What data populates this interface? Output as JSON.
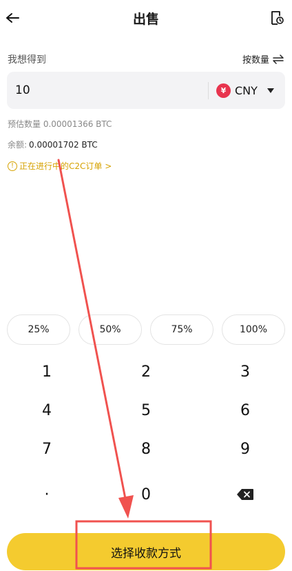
{
  "header": {
    "title": "出售"
  },
  "form": {
    "want_label": "我想得到",
    "by_quantity_label": "按数量",
    "amount_value": "10",
    "currency_symbol": "¥",
    "currency_code": "CNY",
    "estimate_text": "预估数量 0.00001366 BTC",
    "balance_label": "余额:",
    "balance_value": "0.00001702 BTC",
    "c2c_link_text": "正在进行中的C2C订单 >"
  },
  "percent_buttons": [
    "25%",
    "50%",
    "75%",
    "100%"
  ],
  "keypad": {
    "keys": [
      "1",
      "2",
      "3",
      "4",
      "5",
      "6",
      "7",
      "8",
      "9",
      "·",
      "0"
    ]
  },
  "submit": {
    "label": "选择收款方式"
  },
  "colors": {
    "accent": "#f4cb2f",
    "link": "#d6a200",
    "annotation": "#f0524f",
    "currency_badge": "#e8344e"
  }
}
